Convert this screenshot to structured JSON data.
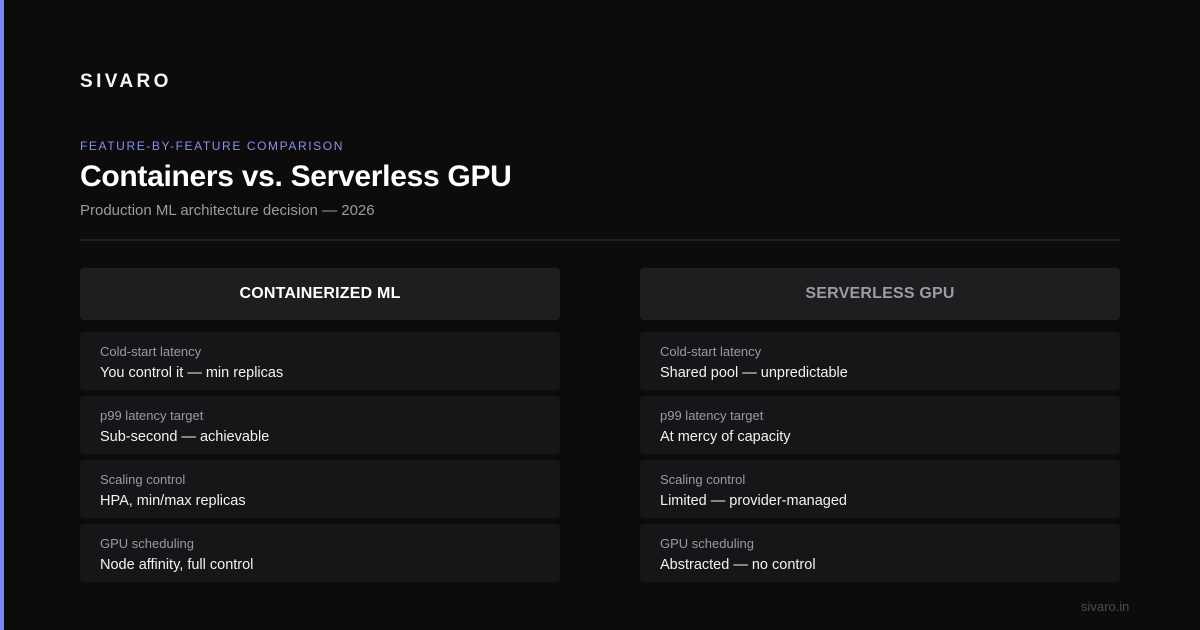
{
  "brand": "SIVARO",
  "eyebrow": "FEATURE-BY-FEATURE COMPARISON",
  "title": "Containers vs. Serverless GPU",
  "subtitle": "Production ML architecture decision — 2026",
  "colors": {
    "accent": "#7c85f5",
    "background": "#0c0c0d"
  },
  "columns": [
    {
      "header": "CONTAINERIZED ML",
      "rows": [
        {
          "label": "Cold-start latency",
          "value": "You control it — min replicas"
        },
        {
          "label": "p99 latency target",
          "value": "Sub-second — achievable"
        },
        {
          "label": "Scaling control",
          "value": "HPA, min/max replicas"
        },
        {
          "label": "GPU scheduling",
          "value": "Node affinity, full control"
        }
      ]
    },
    {
      "header": "SERVERLESS GPU",
      "rows": [
        {
          "label": "Cold-start latency",
          "value": "Shared pool — unpredictable"
        },
        {
          "label": "p99 latency target",
          "value": "At mercy of capacity"
        },
        {
          "label": "Scaling control",
          "value": "Limited — provider-managed"
        },
        {
          "label": "GPU scheduling",
          "value": "Abstracted — no control"
        }
      ]
    }
  ],
  "footer": {
    "url": "sivaro.in"
  }
}
